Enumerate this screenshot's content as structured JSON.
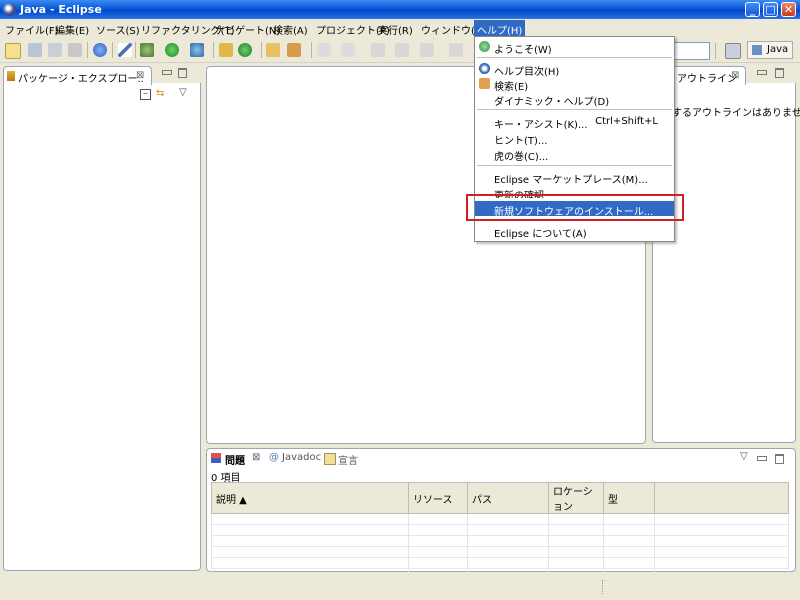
{
  "window": {
    "title": "Java - Eclipse",
    "controls": {
      "minimize": "_",
      "maximize": "□",
      "close": "✕"
    }
  },
  "menubar": {
    "items": [
      "ファイル(F)",
      "編集(E)",
      "ソース(S)",
      "リファクタリング(T)",
      "ナビゲート(N)",
      "検索(A)",
      "プロジェクト(P)",
      "実行(R)",
      "ウィンドウ(W)",
      "ヘルプ(H)"
    ],
    "active": "ヘルプ(H)"
  },
  "perspective": {
    "label": "Java"
  },
  "package_explorer": {
    "tab_label": "パッケージ・エクスプロー..",
    "close": "⊠"
  },
  "outline": {
    "tab_label": "アウトライン",
    "close": "⊠",
    "message": "するアウトラインはありません。"
  },
  "problems_view": {
    "tabs": [
      {
        "label": "問題",
        "close": "⊠",
        "icon": "problems-icon"
      },
      {
        "label": "Javadoc",
        "icon": "javadoc-icon"
      },
      {
        "label": "宣言",
        "icon": "declaration-icon"
      }
    ],
    "item_count": "0 項目",
    "columns": [
      "説明 ▲",
      "リソース",
      "パス",
      "ロケーション",
      "型"
    ]
  },
  "help_menu": {
    "items": [
      {
        "label": "ようこそ(W)",
        "icon": "welcome-icon"
      },
      {
        "label": "ヘルプ目次(H)",
        "icon": "help-contents-icon"
      },
      {
        "label": "検索(E)",
        "icon": "search-help-icon"
      },
      {
        "label": "ダイナミック・ヘルプ(D)"
      },
      {
        "label": "キー・アシスト(K)...",
        "accelerator": "Ctrl+Shift+L"
      },
      {
        "label": "ヒント(T)..."
      },
      {
        "label": "虎の巻(C)..."
      },
      {
        "label": "Eclipse マーケットプレース(M)..."
      },
      {
        "label": "更新の確認"
      },
      {
        "label": "新規ソフトウェアのインストール..."
      },
      {
        "label": "Eclipse について(A)"
      }
    ],
    "highlighted": "新規ソフトウェアのインストール..."
  },
  "colors": {
    "highlight": "#316ac5",
    "annotation": "#d21f1f",
    "titlebar": "#0a5ad8"
  }
}
